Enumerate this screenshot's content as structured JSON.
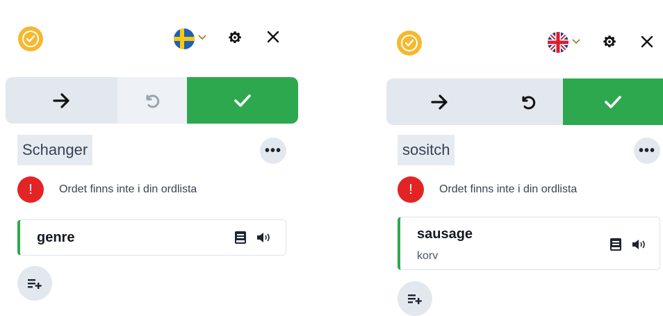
{
  "left_panel": {
    "toolbar": {
      "app_logo": "check-circle-icon",
      "language_flag": "sweden-flag",
      "settings_icon": "gear-icon",
      "close_icon": "close-icon"
    },
    "actions": {
      "next_icon": "arrow-right-icon",
      "undo_icon": "undo-icon",
      "accept_icon": "check-icon",
      "accent_color": "#2ea84f"
    },
    "word": "Schanger",
    "more_label": "•••",
    "warning": {
      "badge": "!",
      "text": "Ordet finns inte i din ordlista"
    },
    "suggestion": {
      "translation": "genre"
    }
  },
  "right_panel": {
    "toolbar": {
      "app_logo": "check-circle-icon",
      "language_flag": "uk-flag",
      "settings_icon": "gear-icon",
      "close_icon": "close-icon"
    },
    "actions": {
      "next_icon": "arrow-right-icon",
      "undo_icon": "undo-icon",
      "accept_icon": "check-icon",
      "accent_color": "#2ea84f"
    },
    "word": "sositch",
    "more_label": "•••",
    "warning": {
      "badge": "!",
      "text": "Ordet finns inte i din ordlista"
    },
    "suggestion": {
      "translation": "sausage",
      "subtitle": "korv"
    }
  }
}
